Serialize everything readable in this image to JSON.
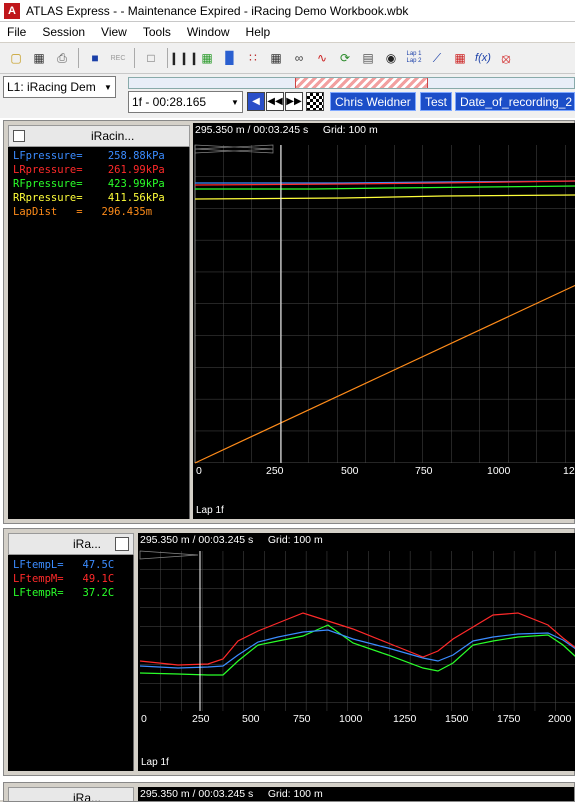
{
  "window": {
    "title": "ATLAS Express -  - Maintenance Expired - iRacing Demo Workbook.wbk"
  },
  "menu": [
    "File",
    "Session",
    "View",
    "Tools",
    "Window",
    "Help"
  ],
  "toolbar": [
    "open-folder-icon",
    "save-icon",
    "print-icon",
    "export-icon",
    "rec-icon",
    "page-icon",
    "bars-icon",
    "grid-icon",
    "histogram-icon",
    "scatter-icon",
    "table-icon",
    "cluster-icon",
    "wave-icon",
    "cycle-icon",
    "layout-icon",
    "camera-icon",
    "lap-compare-icon",
    "line-icon",
    "matrix-icon",
    "function-icon",
    "stop-icon"
  ],
  "toolbar_labels": {
    "lap_compare": "Lap 1\nLap 2",
    "rec": "REC"
  },
  "session": {
    "lap": "L1: iRacing Dem",
    "time": "1f - 00:28.165",
    "chips": [
      "Chris Weidner",
      "Test",
      "Date_of_recording_2"
    ]
  },
  "panel1": {
    "legend_title": "iRacin...",
    "header": "295.350 m / 00:03.245 s     Grid: 100 m",
    "lap": "Lap 1f",
    "channels": [
      {
        "line": "LFpressure=    258.88kPa",
        "color": "#3b8cff"
      },
      {
        "line": "LRpressure=    261.99kPa",
        "color": "#ff2a2a"
      },
      {
        "line": "RFpressure=    423.99kPa",
        "color": "#2aff2a"
      },
      {
        "line": "RRpressure=    411.56kPa",
        "color": "#ffff3a"
      },
      {
        "line": "LapDist   =   296.435m",
        "color": "#ff8c1a"
      }
    ],
    "xticks": [
      "0",
      "250",
      "500",
      "750",
      "1000",
      "12"
    ]
  },
  "panel2": {
    "legend_title": "iRa...",
    "header": "295.350 m / 00:03.245 s     Grid: 100 m",
    "lap": "Lap 1f",
    "channels": [
      {
        "line": "LFtempL=   47.5C",
        "color": "#3b8cff"
      },
      {
        "line": "LFtempM=   49.1C",
        "color": "#ff2a2a"
      },
      {
        "line": "LFtempR=   37.2C",
        "color": "#2aff2a"
      }
    ],
    "xticks": [
      "0",
      "250",
      "500",
      "750",
      "1000",
      "1250",
      "1500",
      "1750",
      "2000"
    ]
  },
  "panel3": {
    "legend_title": "iRa...",
    "header": "295.350 m / 00:03.245 s     Grid: 100 m"
  }
}
